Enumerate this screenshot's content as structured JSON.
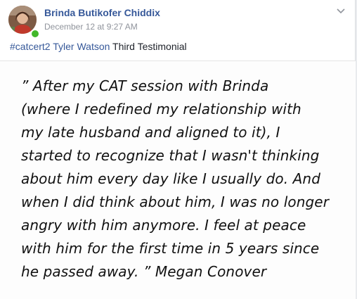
{
  "post": {
    "author": "Brinda Butikofer Chiddix",
    "timestamp": "December 12 at 9:27 AM",
    "caption": {
      "hashtag": "#catcert2",
      "mention": "Tyler Watson",
      "text": "Third Testimonial"
    },
    "image_text_lines": [
      "” After my CAT session with Brinda",
      "(where I redefined my relationship with",
      "my late husband and aligned to it), I",
      "started to recognize that I wasn't thinking",
      "about him every day like I usually do. And",
      "when I did think about him, I was no longer",
      "angry with him anymore. I feel at peace",
      "with him for the first time in 5 years since",
      "he passed away. ” Megan Conover"
    ]
  },
  "colors": {
    "link": "#365899",
    "meta": "#90949c",
    "online": "#42b72a"
  },
  "icons": {
    "menu": "chevron-down-icon",
    "presence": "online-status-icon"
  }
}
